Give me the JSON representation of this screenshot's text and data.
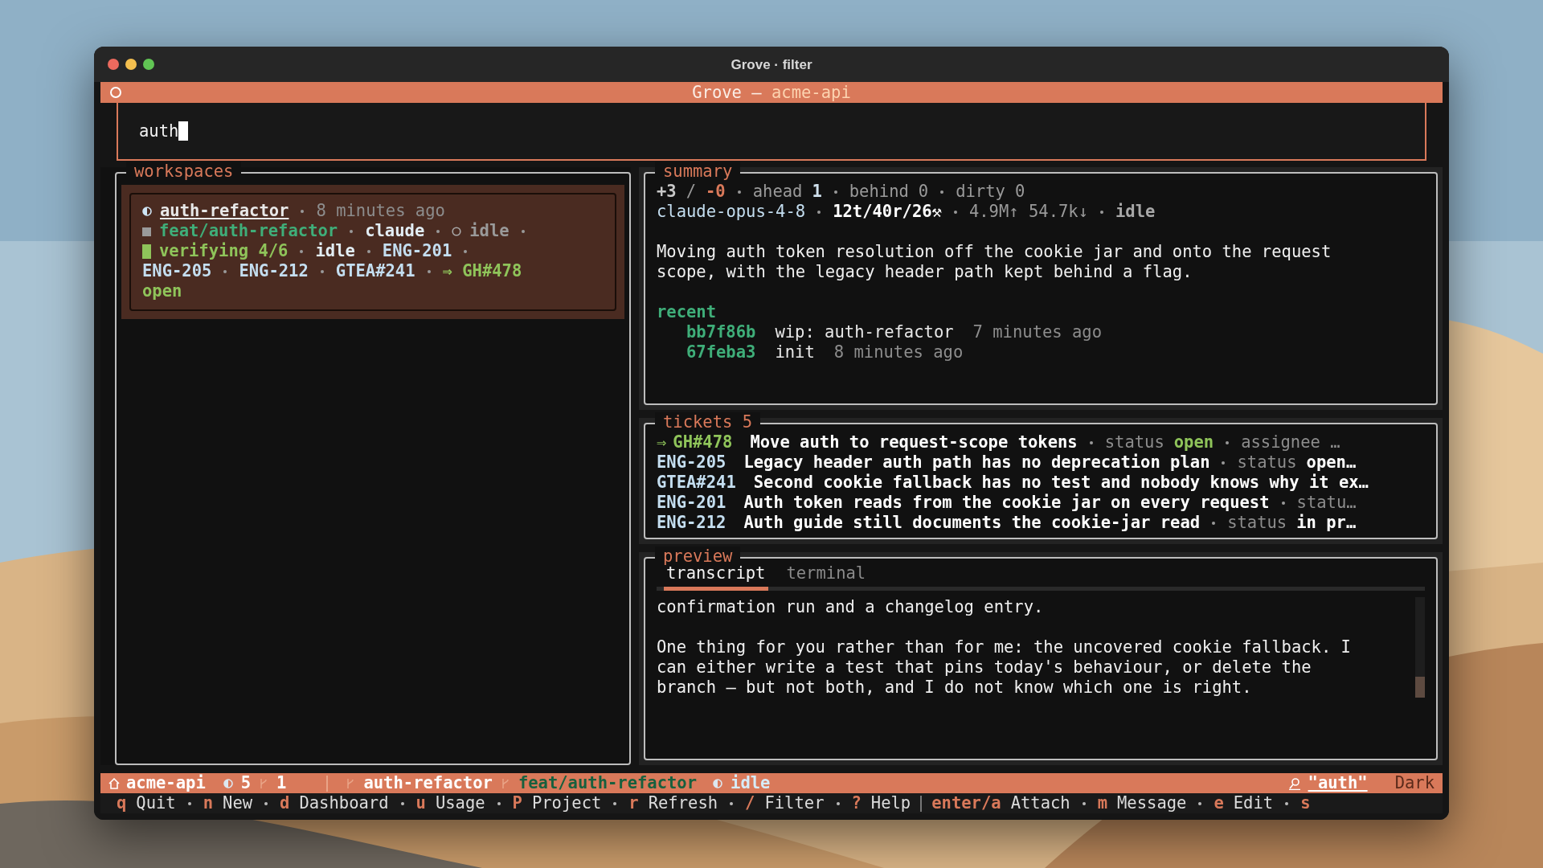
{
  "window": {
    "title": "Grove · filter"
  },
  "header": {
    "app": "Grove",
    "dash": "—",
    "project": "acme-api"
  },
  "filter": {
    "value": "auth"
  },
  "workspaces": {
    "title": "workspaces",
    "items": [
      {
        "selected": true,
        "name": "auth-refactor",
        "time": "8 minutes ago",
        "branch": "feat/auth-refactor",
        "agent": "claude",
        "agent_state": "idle",
        "progress": "verifying 4/6",
        "activity": "idle",
        "tickets": [
          "ENG-201",
          "ENG-205",
          "ENG-212",
          "GTEA#241"
        ],
        "arrow": "⇒",
        "linked": "GH#478",
        "linked_state": "open"
      }
    ]
  },
  "summary": {
    "title": "summary",
    "added": "+3",
    "slash": "/",
    "removed": "-0",
    "stats": [
      {
        "label": "ahead",
        "value": "1",
        "highlight": true
      },
      {
        "label": "behind",
        "value": "0",
        "highlight": false
      },
      {
        "label": "dirty",
        "value": "0",
        "highlight": false
      }
    ],
    "model": "claude-opus-4-8",
    "counts": "12t/40r/26⚒",
    "tokens": "4.9M↑ 54.7k↓",
    "state": "idle",
    "description": "Moving auth token resolution off the cookie jar and onto the request scope, with the legacy header path kept behind a flag.",
    "recent_title": "recent",
    "recent": [
      {
        "hash": "bb7f86b",
        "message": "wip: auth-refactor",
        "time": "7 minutes ago"
      },
      {
        "hash": "67feba3",
        "message": "init",
        "time": "8 minutes ago"
      }
    ]
  },
  "tickets": {
    "title": "tickets",
    "count": "5",
    "rows": [
      {
        "linked": true,
        "arrow": "⇒",
        "id": "GH#478",
        "title": "Move auth to request-scope tokens",
        "meta_label": "status",
        "meta_value": "open",
        "more": "assignee …"
      },
      {
        "linked": false,
        "id": "ENG-205",
        "title": "Legacy header auth path has no deprecation plan",
        "meta_label": "status",
        "meta_value": "open…"
      },
      {
        "linked": false,
        "id": "GTEA#241",
        "title": "Second cookie fallback has no test and nobody knows why it ex…"
      },
      {
        "linked": false,
        "id": "ENG-201",
        "title": "Auth token reads from the cookie jar on every request",
        "meta_label": "statu…"
      },
      {
        "linked": false,
        "id": "ENG-212",
        "title": "Auth guide still documents the cookie-jar read",
        "meta_label": "status",
        "meta_value": "in pr…"
      }
    ]
  },
  "preview": {
    "title": "preview",
    "tabs": [
      {
        "label": "transcript",
        "selected": true
      },
      {
        "label": "terminal",
        "selected": false
      }
    ],
    "paragraphs": [
      "confirmation run and a changelog entry.",
      "One thing for you rather than for me: the uncovered cookie fallback. I can either write a test that pins today's behaviour, or delete the branch — but not both, and I do not know which one is right."
    ]
  },
  "status_bar": {
    "project": "acme-api",
    "workspaces": "5",
    "branches": "1",
    "workspace": "auth-refactor",
    "branch": "feat/auth-refactor",
    "state": "idle",
    "filter": "\"auth\"",
    "theme": "Dark"
  },
  "key_groups": [
    [
      {
        "key": "q",
        "label": "Quit"
      },
      {
        "key": "n",
        "label": "New"
      },
      {
        "key": "d",
        "label": "Dashboard"
      },
      {
        "key": "u",
        "label": "Usage"
      },
      {
        "key": "P",
        "label": "Project"
      },
      {
        "key": "r",
        "label": "Refresh"
      },
      {
        "key": "/",
        "label": "Filter"
      },
      {
        "key": "?",
        "label": "Help"
      }
    ],
    [
      {
        "key": "enter/a",
        "label": "Attach"
      },
      {
        "key": "m",
        "label": "Message"
      },
      {
        "key": "e",
        "label": "Edit"
      },
      {
        "key": "s"
      }
    ]
  ]
}
